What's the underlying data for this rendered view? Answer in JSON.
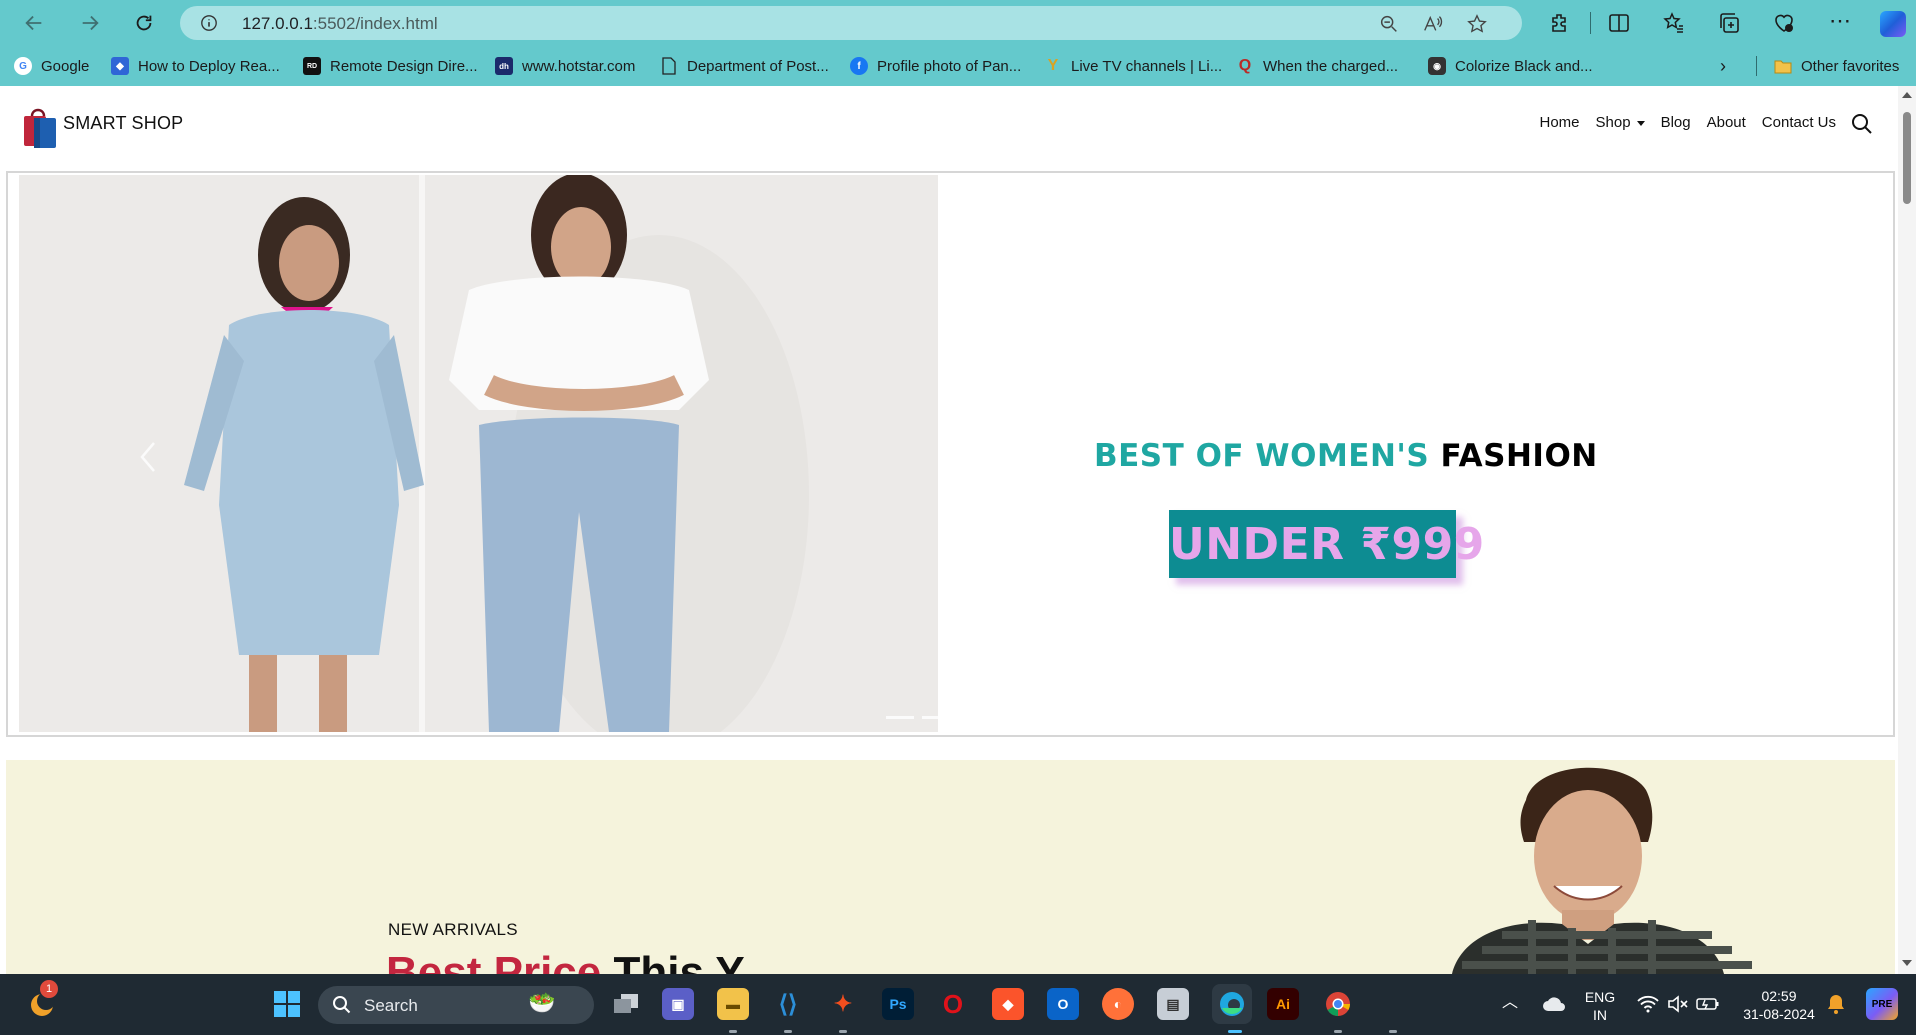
{
  "browser": {
    "url_host": "127.0.0.1",
    "url_rest": ":5502/index.html",
    "favorites": [
      {
        "label": "Google",
        "icon": "google-icon",
        "color": "#ffffff"
      },
      {
        "label": "How to Deploy Rea...",
        "icon": "deploy-icon",
        "color": "#2f66d6"
      },
      {
        "label": "Remote Design Dire...",
        "icon": "remote-design-icon",
        "color": "#111111"
      },
      {
        "label": "www.hotstar.com",
        "icon": "hotstar-icon",
        "color": "#1b2a6b"
      },
      {
        "label": "Department of Post...",
        "icon": "page-icon",
        "color": "#ffffff"
      },
      {
        "label": "Profile photo of Pan...",
        "icon": "facebook-icon",
        "color": "#1877f2"
      },
      {
        "label": "Live TV channels | Li...",
        "icon": "live-tv-icon",
        "color": "#d9a323"
      },
      {
        "label": "When the charged...",
        "icon": "quora-icon",
        "color": "#b92b27"
      },
      {
        "label": "Colorize Black and...",
        "icon": "colorize-icon",
        "color": "#333333"
      }
    ],
    "other_favorites": "Other favorites"
  },
  "site": {
    "brand": "SMART SHOP",
    "menu": {
      "home": "Home",
      "shop": "Shop",
      "blog": "Blog",
      "about": "About",
      "contact": "Contact Us"
    }
  },
  "hero": {
    "title_part1": "BEST OF WOMEN'S",
    "title_part2": "FASHION",
    "price_text": "UNDER  ₹999",
    "accent_color": "#1fa7a2",
    "price_bg": "#0d8c92",
    "price_color": "#e6a6ea"
  },
  "arrivals": {
    "label": "NEW ARRIVALS",
    "heading_part1": "Best Price",
    "heading_part2": "This Y..."
  },
  "taskbar": {
    "search_label": "Search",
    "notification_count": "1",
    "lang_top": "ENG",
    "lang_bottom": "IN",
    "time": "02:59",
    "date": "31-08-2024"
  }
}
